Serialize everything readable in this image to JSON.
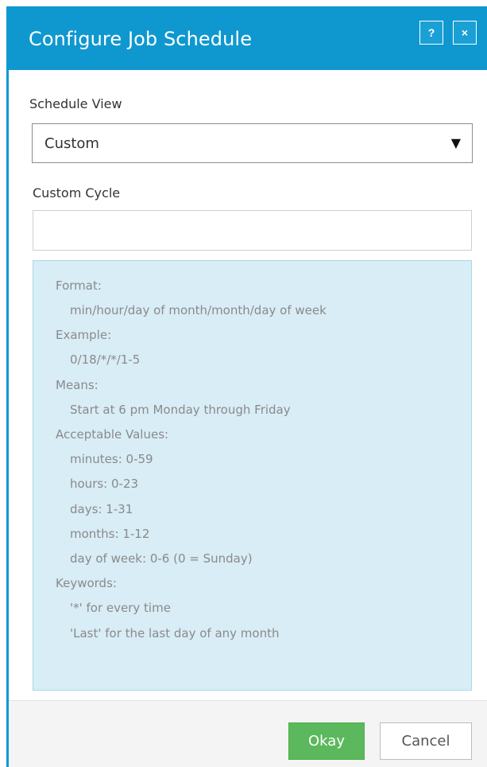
{
  "dialog": {
    "title": "Configure Job Schedule",
    "help_label": "?",
    "close_label": "×"
  },
  "schedule_view": {
    "label": "Schedule View",
    "selected": "Custom",
    "caret": "▼"
  },
  "custom_cycle": {
    "label": "Custom Cycle",
    "value": "",
    "placeholder": ""
  },
  "info": {
    "format_heading": "Format:",
    "format_value": "min/hour/day of month/month/day of week",
    "example_heading": "Example:",
    "example_value": "0/18/*/*/1-5",
    "means_heading": "Means:",
    "means_value": "Start at 6 pm Monday through Friday",
    "acceptable_heading": "Acceptable Values:",
    "acceptable_values": [
      "minutes: 0-59",
      "hours: 0-23",
      "days: 1-31",
      "months: 1-12",
      "day of week: 0-6 (0 = Sunday)"
    ],
    "keywords_heading": "Keywords:",
    "keywords": [
      "'*' for every time",
      "'Last' for the last day of any month"
    ]
  },
  "footer": {
    "okay_label": "Okay",
    "cancel_label": "Cancel"
  },
  "colors": {
    "title_bar": "#0f98cf",
    "info_background": "#d8edf6",
    "okay_button": "#5cb85c"
  }
}
